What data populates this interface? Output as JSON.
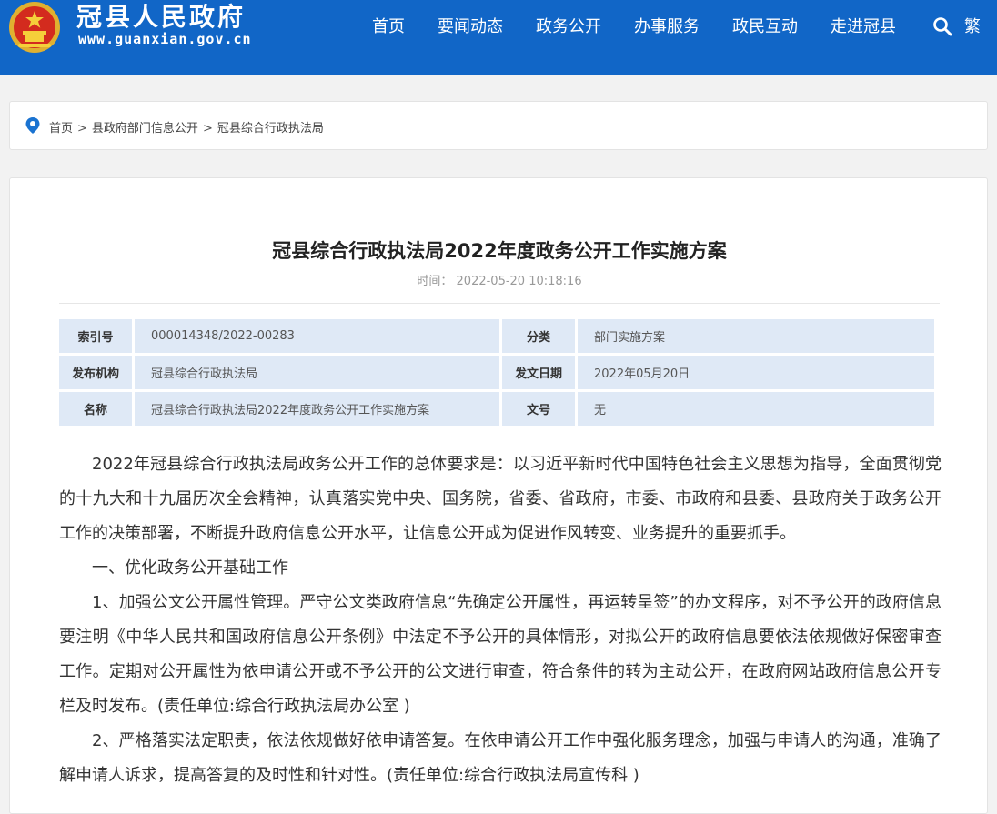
{
  "header": {
    "site_name": "冠县人民政府",
    "site_url": "www.guanxian.gov.cn",
    "nav": [
      {
        "label": "首页"
      },
      {
        "label": "要闻动态"
      },
      {
        "label": "政务公开"
      },
      {
        "label": "办事服务"
      },
      {
        "label": "政民互动"
      },
      {
        "label": "走进冠县"
      }
    ],
    "search_icon": "search-icon",
    "lang_toggle": "繁",
    "brand_color": "#1166c7"
  },
  "breadcrumb": {
    "icon": "location-pin-icon",
    "items": [
      "首页",
      "县政府部门信息公开",
      "冠县综合行政执法局"
    ],
    "separator": ">"
  },
  "article": {
    "title": "冠县综合行政执法局2022年度政务公开工作实施方案",
    "time_label": "时间：",
    "time_value": "2022-05-20 10:18:16",
    "meta": {
      "index_label": "索引号",
      "index_value": "000014348/2022-00283",
      "category_label": "分类",
      "category_value": "部门实施方案",
      "publisher_label": "发布机构",
      "publisher_value": "冠县综合行政执法局",
      "date_label": "发文日期",
      "date_value": "2022年05月20日",
      "name_label": "名称",
      "name_value": "冠县综合行政执法局2022年度政务公开工作实施方案",
      "docno_label": "文号",
      "docno_value": "无"
    },
    "paragraphs": [
      "2022年冠县综合行政执法局政务公开工作的总体要求是：以习近平新时代中国特色社会主义思想为指导，全面贯彻党的十九大和十九届历次全会精神，认真落实党中央、国务院，省委、省政府，市委、市政府和县委、县政府关于政务公开工作的决策部署，不断提升政府信息公开水平，让信息公开成为促进作风转变、业务提升的重要抓手。",
      "一、优化政务公开基础工作",
      "1、加强公文公开属性管理。严守公文类政府信息“先确定公开属性，再运转呈签”的办文程序，对不予公开的政府信息要注明《中华人民共和国政府信息公开条例》中法定不予公开的具体情形，对拟公开的政府信息要依法依规做好保密审查工作。定期对公开属性为依申请公开或不予公开的公文进行审查，符合条件的转为主动公开，在政府网站政府信息公开专栏及时发布。(责任单位:综合行政执法局办公室 )",
      "2、严格落实法定职责，依法依规做好依申请答复。在依申请公开工作中强化服务理念，加强与申请人的沟通，准确了解申请人诉求，提高答复的及时性和针对性。(责任单位:综合行政执法局宣传科 )"
    ]
  }
}
